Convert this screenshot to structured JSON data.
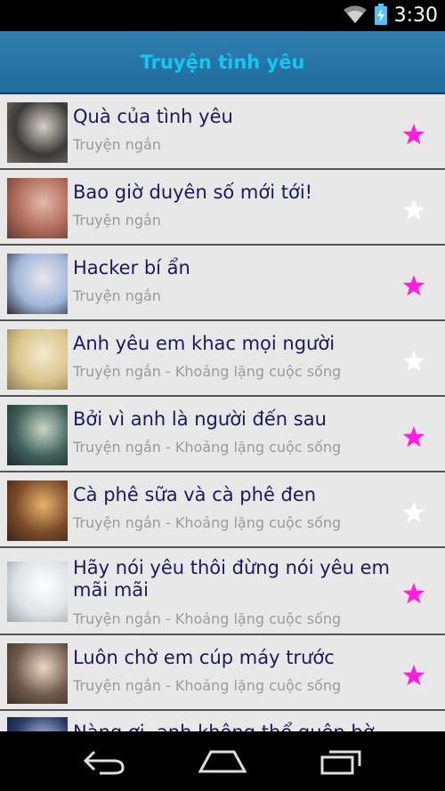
{
  "status": {
    "time": "3:30"
  },
  "header": {
    "title": "Truyện tình yêu"
  },
  "items": [
    {
      "title": "Quà của tình yêu",
      "subtitle": "Truyện ngắn",
      "favorite": true,
      "thumb": [
        "#3a3a3a",
        "#d9d0c6",
        "#7a6f66"
      ]
    },
    {
      "title": "Bao giờ duyên số mới tới!",
      "subtitle": "Truyện ngắn",
      "favorite": false,
      "thumb": [
        "#b06a5a",
        "#e2b9a8",
        "#5b3b34"
      ]
    },
    {
      "title": "Hacker bí ẩn",
      "subtitle": "Truyện ngắn",
      "favorite": true,
      "thumb": [
        "#9fb7d8",
        "#ece6ee",
        "#2f2a35"
      ]
    },
    {
      "title": "Anh yêu em khac mọi người",
      "subtitle": "Truyện ngắn - Khoảng lặng cuộc sống",
      "favorite": false,
      "thumb": [
        "#d9c48a",
        "#f3ead0",
        "#8a7a5a"
      ]
    },
    {
      "title": "Bởi vì anh là người đến sau",
      "subtitle": "Truyện ngắn - Khoảng lặng cuộc sống",
      "favorite": true,
      "thumb": [
        "#3f5f5a",
        "#c9d8c5",
        "#1d2a2a"
      ]
    },
    {
      "title": "Cà phê sữa và cà phê đen",
      "subtitle": "Truyện ngắn - Khoảng lặng cuộc sống",
      "favorite": false,
      "thumb": [
        "#7a4a2a",
        "#e8b46a",
        "#3a2418"
      ]
    },
    {
      "title": "Hãy nói yêu thôi đừng nói yêu em mãi mãi",
      "subtitle": "Truyện ngắn - Khoảng lặng cuộc sống",
      "favorite": true,
      "thumb": [
        "#dfe3e6",
        "#ffffff",
        "#9aa3a8"
      ]
    },
    {
      "title": "Luôn chờ em cúp máy trước",
      "subtitle": "Truyện ngắn - Khoảng lặng cuộc sống",
      "favorite": true,
      "thumb": [
        "#6f5a4c",
        "#e9d7c6",
        "#3a2f28"
      ]
    },
    {
      "title": "Nàng ơi, anh không thể quên bờ vai đó",
      "subtitle": "",
      "favorite": false,
      "thumb": [
        "#2a3b66",
        "#b9c7e6",
        "#0e1630"
      ]
    }
  ],
  "colors": {
    "star_on": "#ff1fe0",
    "star_off": "#ffffff"
  }
}
